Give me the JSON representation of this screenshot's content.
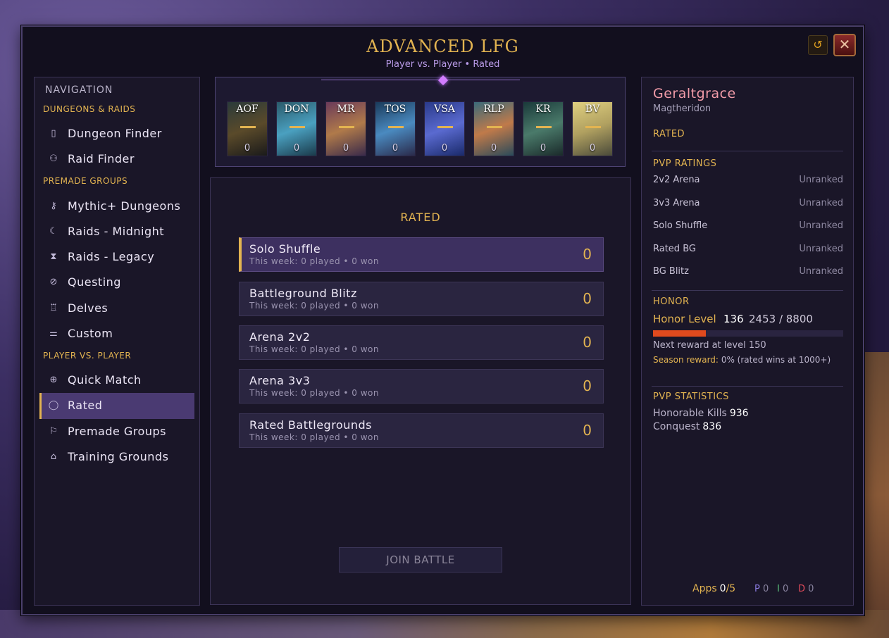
{
  "window": {
    "title": "ADVANCED LFG",
    "subtitle": "Player vs. Player • Rated",
    "reset_icon": "↺",
    "close_icon": "✕"
  },
  "nav": {
    "title": "NAVIGATION",
    "sections": [
      {
        "label": "DUNGEONS & RAIDS"
      },
      {
        "label": "PREMADE GROUPS"
      },
      {
        "label": "PLAYER VS. PLAYER"
      }
    ],
    "items": [
      {
        "label": "Dungeon Finder",
        "icon": "door-icon"
      },
      {
        "label": "Raid Finder",
        "icon": "people-icon"
      },
      {
        "label": "Mythic+ Dungeons",
        "icon": "key-icon"
      },
      {
        "label": "Raids - Midnight",
        "icon": "moon-icon"
      },
      {
        "label": "Raids - Legacy",
        "icon": "hourglass-icon"
      },
      {
        "label": "Questing",
        "icon": "compass-icon"
      },
      {
        "label": "Delves",
        "icon": "lantern-icon"
      },
      {
        "label": "Custom",
        "icon": "sliders-icon"
      },
      {
        "label": "Quick Match",
        "icon": "crosshair-icon"
      },
      {
        "label": "Rated",
        "icon": "badge-icon",
        "active": true
      },
      {
        "label": "Premade Groups",
        "icon": "flag-icon"
      },
      {
        "label": "Training Grounds",
        "icon": "robot-icon"
      }
    ]
  },
  "tiles": [
    {
      "abbr": "AOF",
      "count": "0",
      "colors": [
        "#2a3a3a",
        "#5a4a2a",
        "#1a1a1a"
      ]
    },
    {
      "abbr": "DON",
      "count": "0",
      "colors": [
        "#2a5a6a",
        "#4aa0c0",
        "#1a3a4a"
      ]
    },
    {
      "abbr": "MR",
      "count": "0",
      "colors": [
        "#6a3a5a",
        "#b07a4a",
        "#3a2a4a"
      ]
    },
    {
      "abbr": "TOS",
      "count": "0",
      "colors": [
        "#1a3a5a",
        "#4a8ac0",
        "#2a2a4a"
      ]
    },
    {
      "abbr": "VSA",
      "count": "0",
      "colors": [
        "#2a3a8a",
        "#5a6ad0",
        "#1a2a6a"
      ]
    },
    {
      "abbr": "RLP",
      "count": "0",
      "colors": [
        "#3a6a7a",
        "#c07a4a",
        "#2a4a5a"
      ]
    },
    {
      "abbr": "KR",
      "count": "0",
      "colors": [
        "#1a3a3a",
        "#4a7a6a",
        "#1a2a2a"
      ]
    },
    {
      "abbr": "BV",
      "count": "0",
      "colors": [
        "#e0d080",
        "#b0a060",
        "#4a4a3a"
      ]
    }
  ],
  "center": {
    "heading": "RATED",
    "rows": [
      {
        "name": "Solo Shuffle",
        "stats": "This week: 0 played • 0 won",
        "value": "0",
        "selected": true
      },
      {
        "name": "Battleground Blitz",
        "stats": "This week: 0 played • 0 won",
        "value": "0"
      },
      {
        "name": "Arena 2v2",
        "stats": "This week: 0 played • 0 won",
        "value": "0"
      },
      {
        "name": "Arena 3v3",
        "stats": "This week: 0 played • 0 won",
        "value": "0"
      },
      {
        "name": "Rated Battlegrounds",
        "stats": "This week: 0 played • 0 won",
        "value": "0"
      }
    ],
    "join_label": "JOIN BATTLE"
  },
  "character": {
    "name": "Geraltgrace",
    "realm": "Magtheridon",
    "mode": "RATED",
    "ratings_heading": "PVP RATINGS",
    "ratings": [
      {
        "label": "2v2 Arena",
        "value": "Unranked"
      },
      {
        "label": "3v3 Arena",
        "value": "Unranked"
      },
      {
        "label": "Solo Shuffle",
        "value": "Unranked"
      },
      {
        "label": "Rated BG",
        "value": "Unranked"
      },
      {
        "label": "BG Blitz",
        "value": "Unranked"
      }
    ],
    "honor_heading": "HONOR",
    "honor_label": "Honor Level",
    "honor_level": "136",
    "honor_progress": "2453 / 8800",
    "honor_current": 2453,
    "honor_max": 8800,
    "next_reward": "Next reward at level 150",
    "season_label": "Season reward:",
    "season_value": "0% (rated wins at 1000+)",
    "stats_heading": "PVP STATISTICS",
    "stats": [
      {
        "label": "Honorable Kills",
        "value": "936"
      },
      {
        "label": "Conquest",
        "value": "836"
      }
    ],
    "apps_label": "Apps",
    "apps_current": "0",
    "apps_max": "/5",
    "roles": [
      {
        "letter": "P",
        "count": "0",
        "color": "#8a7ae0"
      },
      {
        "letter": "I",
        "count": "0",
        "color": "#5ac07a"
      },
      {
        "letter": "D",
        "count": "0",
        "color": "#e04a5a"
      }
    ]
  }
}
